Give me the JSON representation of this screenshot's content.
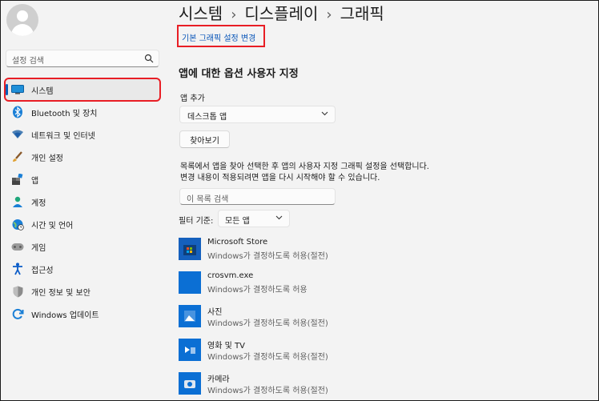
{
  "sidebar": {
    "search_placeholder": "설정 검색",
    "items": [
      {
        "label": "시스템",
        "icon": "system-icon"
      },
      {
        "label": "Bluetooth 및 장치",
        "icon": "bluetooth-icon"
      },
      {
        "label": "네트워크 및 인터넷",
        "icon": "wifi-icon"
      },
      {
        "label": "개인 설정",
        "icon": "brush-icon"
      },
      {
        "label": "앱",
        "icon": "apps-icon"
      },
      {
        "label": "계정",
        "icon": "account-icon"
      },
      {
        "label": "시간 및 언어",
        "icon": "globe-clock-icon"
      },
      {
        "label": "게임",
        "icon": "gamepad-icon"
      },
      {
        "label": "접근성",
        "icon": "accessibility-icon"
      },
      {
        "label": "개인 정보 및 보안",
        "icon": "shield-icon"
      },
      {
        "label": "Windows 업데이트",
        "icon": "update-icon"
      }
    ]
  },
  "breadcrumb": {
    "a": "시스템",
    "b": "디스플레이",
    "c": "그래픽"
  },
  "default_settings_link": "기본 그래픽 설정 변경",
  "section_title": "앱에 대한 옵션 사용자 지정",
  "add_app": {
    "label": "앱 추가",
    "dropdown_value": "데스크톱 앱",
    "browse_button": "찾아보기"
  },
  "description": "목록에서 앱을 찾아 선택한 후 앱의 사용자 지정 그래픽 설정을 선택합니다. 변경 내용이 적용되려면 앱을 다시 시작해야 할 수 있습니다.",
  "list_search_placeholder": "이 목록 검색",
  "filter": {
    "label": "필터 기준:",
    "value": "모든 앱"
  },
  "apps": [
    {
      "name": "Microsoft Store",
      "status": "Windows가 결정하도록 허용(절전)"
    },
    {
      "name": "crosvm.exe",
      "status": "Windows가 결정하도록 허용"
    },
    {
      "name": "사진",
      "status": "Windows가 결정하도록 허용(절전)"
    },
    {
      "name": "영화 및 TV",
      "status": "Windows가 결정하도록 허용(절전)"
    },
    {
      "name": "카메라",
      "status": "Windows가 결정하도록 허용(절전)"
    }
  ],
  "colors": {
    "accent": "#005fb8",
    "highlight": "#e81e25"
  }
}
